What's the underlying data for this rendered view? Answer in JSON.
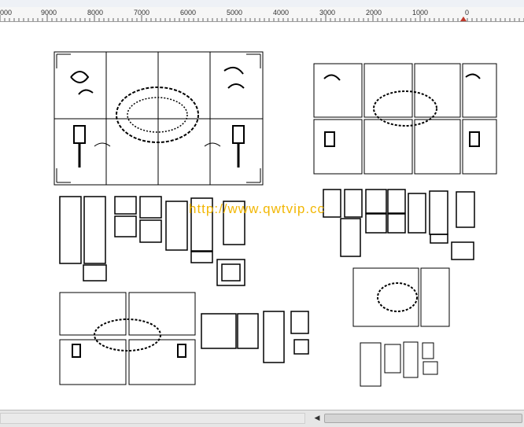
{
  "ruler": {
    "labels": [
      "000",
      "9000",
      "8000",
      "7000",
      "6000",
      "5000",
      "4000",
      "3000",
      "2000",
      "1000",
      "0"
    ]
  },
  "watermark": {
    "text": "http://www.qwtvip.cc"
  },
  "scrollbar": {
    "left_arrow": "◀",
    "right_arrow": "▶"
  },
  "colors": {
    "ruler_mark": "#c0392b",
    "drawing": "#000000",
    "watermark": "#f2b705"
  }
}
